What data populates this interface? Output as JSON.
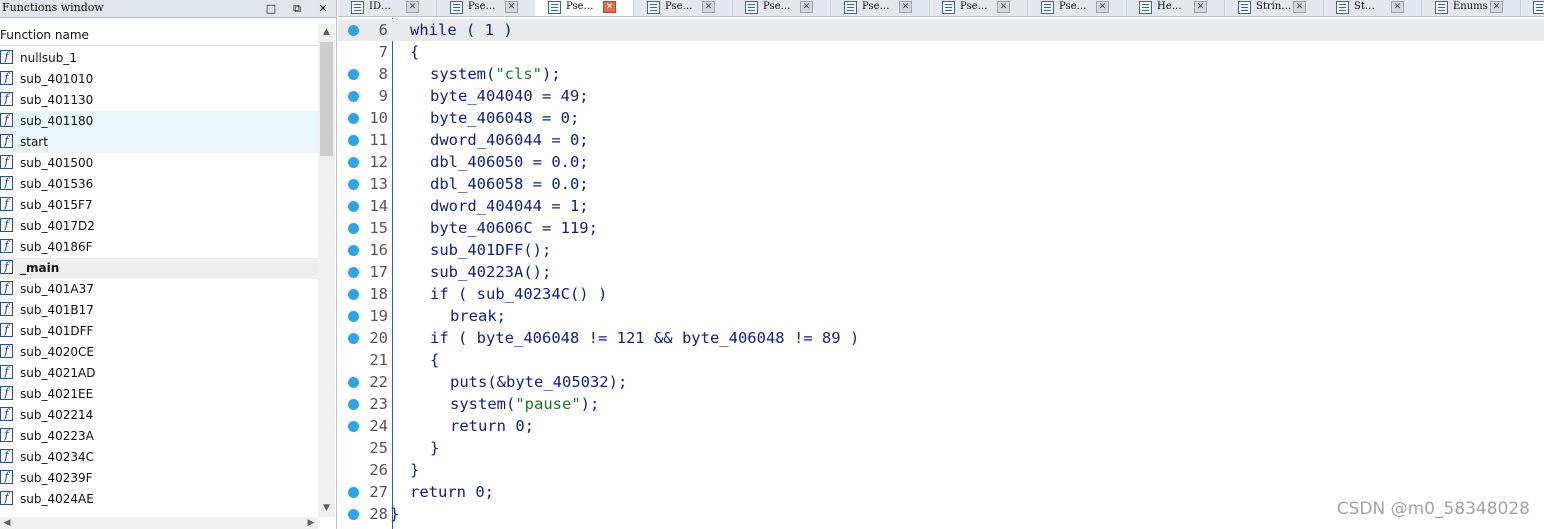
{
  "functions_window": {
    "title": "Functions window",
    "column_header": "Function name",
    "icon": "function-icon",
    "icon_glyph": "f",
    "functions": [
      {
        "name": "nullsub_1",
        "state": "normal"
      },
      {
        "name": "sub_401010",
        "state": "normal"
      },
      {
        "name": "sub_401130",
        "state": "normal"
      },
      {
        "name": "sub_401180",
        "state": "selected"
      },
      {
        "name": "start",
        "state": "selected"
      },
      {
        "name": "sub_401500",
        "state": "normal"
      },
      {
        "name": "sub_401536",
        "state": "normal"
      },
      {
        "name": "sub_4015F7",
        "state": "normal"
      },
      {
        "name": "sub_4017D2",
        "state": "normal"
      },
      {
        "name": "sub_40186F",
        "state": "normal"
      },
      {
        "name": "_main",
        "state": "current"
      },
      {
        "name": "sub_401A37",
        "state": "normal"
      },
      {
        "name": "sub_401B17",
        "state": "normal"
      },
      {
        "name": "sub_401DFF",
        "state": "normal"
      },
      {
        "name": "sub_4020CE",
        "state": "normal"
      },
      {
        "name": "sub_4021AD",
        "state": "normal"
      },
      {
        "name": "sub_4021EE",
        "state": "normal"
      },
      {
        "name": "sub_402214",
        "state": "normal"
      },
      {
        "name": "sub_40223A",
        "state": "normal"
      },
      {
        "name": "sub_40234C",
        "state": "normal"
      },
      {
        "name": "sub_40239F",
        "state": "normal"
      },
      {
        "name": "sub_4024AE",
        "state": "normal"
      }
    ]
  },
  "tabs": [
    {
      "label": "ID…",
      "active": false
    },
    {
      "label": "Pse…",
      "active": false
    },
    {
      "label": "Pse…",
      "active": true
    },
    {
      "label": "Pse…",
      "active": false
    },
    {
      "label": "Pse…",
      "active": false
    },
    {
      "label": "Pse…",
      "active": false
    },
    {
      "label": "Pse…",
      "active": false
    },
    {
      "label": "Pse…",
      "active": false
    },
    {
      "label": "He…",
      "active": false
    },
    {
      "label": "Strin…",
      "active": false
    },
    {
      "label": "St…",
      "active": false
    },
    {
      "label": "Enums",
      "active": false
    }
  ],
  "code": {
    "lines": [
      {
        "num": "6",
        "dot": true,
        "indent": 1,
        "text": "while ( 1 )"
      },
      {
        "num": "7",
        "dot": false,
        "indent": 1,
        "text": "{"
      },
      {
        "num": "8",
        "dot": true,
        "indent": 2,
        "pre": "system(",
        "str": "\"cls\"",
        "post": ");"
      },
      {
        "num": "9",
        "dot": true,
        "indent": 2,
        "text": "byte_404040 = 49;"
      },
      {
        "num": "10",
        "dot": true,
        "indent": 2,
        "text": "byte_406048 = 0;"
      },
      {
        "num": "11",
        "dot": true,
        "indent": 2,
        "text": "dword_406044 = 0;"
      },
      {
        "num": "12",
        "dot": true,
        "indent": 2,
        "text": "dbl_406050 = 0.0;"
      },
      {
        "num": "13",
        "dot": true,
        "indent": 2,
        "text": "dbl_406058 = 0.0;"
      },
      {
        "num": "14",
        "dot": true,
        "indent": 2,
        "text": "dword_404044 = 1;"
      },
      {
        "num": "15",
        "dot": true,
        "indent": 2,
        "text": "byte_40606C = 119;"
      },
      {
        "num": "16",
        "dot": true,
        "indent": 2,
        "text": "sub_401DFF();"
      },
      {
        "num": "17",
        "dot": true,
        "indent": 2,
        "text": "sub_40223A();"
      },
      {
        "num": "18",
        "dot": true,
        "indent": 2,
        "text": "if ( sub_40234C() )"
      },
      {
        "num": "19",
        "dot": true,
        "indent": 3,
        "text": "break;"
      },
      {
        "num": "20",
        "dot": true,
        "indent": 2,
        "text": "if ( byte_406048 != 121 && byte_406048 != 89 )"
      },
      {
        "num": "21",
        "dot": false,
        "indent": 2,
        "text": "{"
      },
      {
        "num": "22",
        "dot": true,
        "indent": 3,
        "text": "puts(&byte_405032);"
      },
      {
        "num": "23",
        "dot": true,
        "indent": 3,
        "pre": "system(",
        "str": "\"pause\"",
        "post": ");"
      },
      {
        "num": "24",
        "dot": true,
        "indent": 3,
        "text": "return 0;"
      },
      {
        "num": "25",
        "dot": false,
        "indent": 2,
        "text": "}"
      },
      {
        "num": "26",
        "dot": false,
        "indent": 1,
        "text": "}"
      },
      {
        "num": "27",
        "dot": true,
        "indent": 1,
        "text": "return 0;"
      },
      {
        "num": "28",
        "dot": true,
        "indent": 0,
        "text": "}"
      }
    ]
  },
  "watermark": "CSDN @m0_58348028",
  "colors": {
    "code_text": "#0c1f8a",
    "string_literal": "#1b7a1b",
    "breakpoint_dot": "#2ea5e6",
    "active_tab_close": "#e36c4b"
  }
}
